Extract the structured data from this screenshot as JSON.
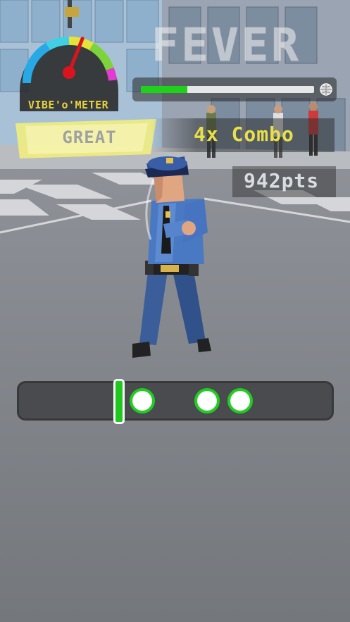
{
  "hud": {
    "fever_title": "FEVER",
    "fever_progress_fraction": 0.27,
    "vibe_meter_label": "VIBE'o'METER",
    "vibe_meter_needle_fraction": 0.62,
    "rating_label": "GREAT",
    "combo_label": "4x Combo",
    "points_label": "942pts"
  },
  "beat_track": {
    "notes": [
      "note",
      "note",
      "note"
    ]
  },
  "colors": {
    "fever_fill": "#1fd11a",
    "rating_banner": "#f3f07a",
    "combo_text": "#e8e04a",
    "note_ring": "#22cc22",
    "hit_marker": "#1ec81e",
    "needle": "#d9141e"
  }
}
